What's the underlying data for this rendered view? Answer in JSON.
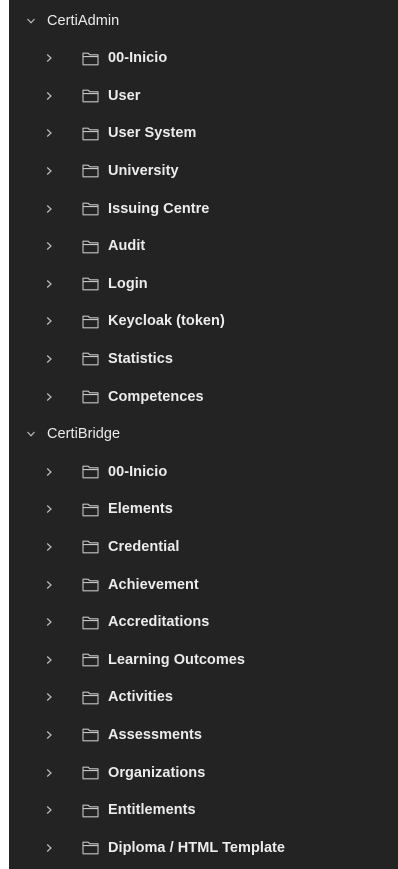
{
  "collections": [
    {
      "name": "CertiAdmin",
      "folders": [
        {
          "label": "00-Inicio"
        },
        {
          "label": "User"
        },
        {
          "label": "User System"
        },
        {
          "label": "University"
        },
        {
          "label": "Issuing Centre"
        },
        {
          "label": "Audit"
        },
        {
          "label": "Login"
        },
        {
          "label": "Keycloak (token)"
        },
        {
          "label": "Statistics"
        },
        {
          "label": "Competences"
        }
      ]
    },
    {
      "name": "CertiBridge",
      "folders": [
        {
          "label": "00-Inicio"
        },
        {
          "label": "Elements"
        },
        {
          "label": "Credential"
        },
        {
          "label": "Achievement"
        },
        {
          "label": "Accreditations"
        },
        {
          "label": "Learning Outcomes"
        },
        {
          "label": "Activities"
        },
        {
          "label": "Assessments"
        },
        {
          "label": "Organizations"
        },
        {
          "label": "Entitlements"
        },
        {
          "label": "Diploma / HTML Template"
        }
      ]
    }
  ],
  "icons": {
    "collection_expand": "chevron-down-icon",
    "folder_expand": "chevron-right-icon",
    "folder": "folder-icon"
  },
  "colors": {
    "panel_background": "#232323",
    "text": "#ececec",
    "icon": "#bdbdbd"
  }
}
